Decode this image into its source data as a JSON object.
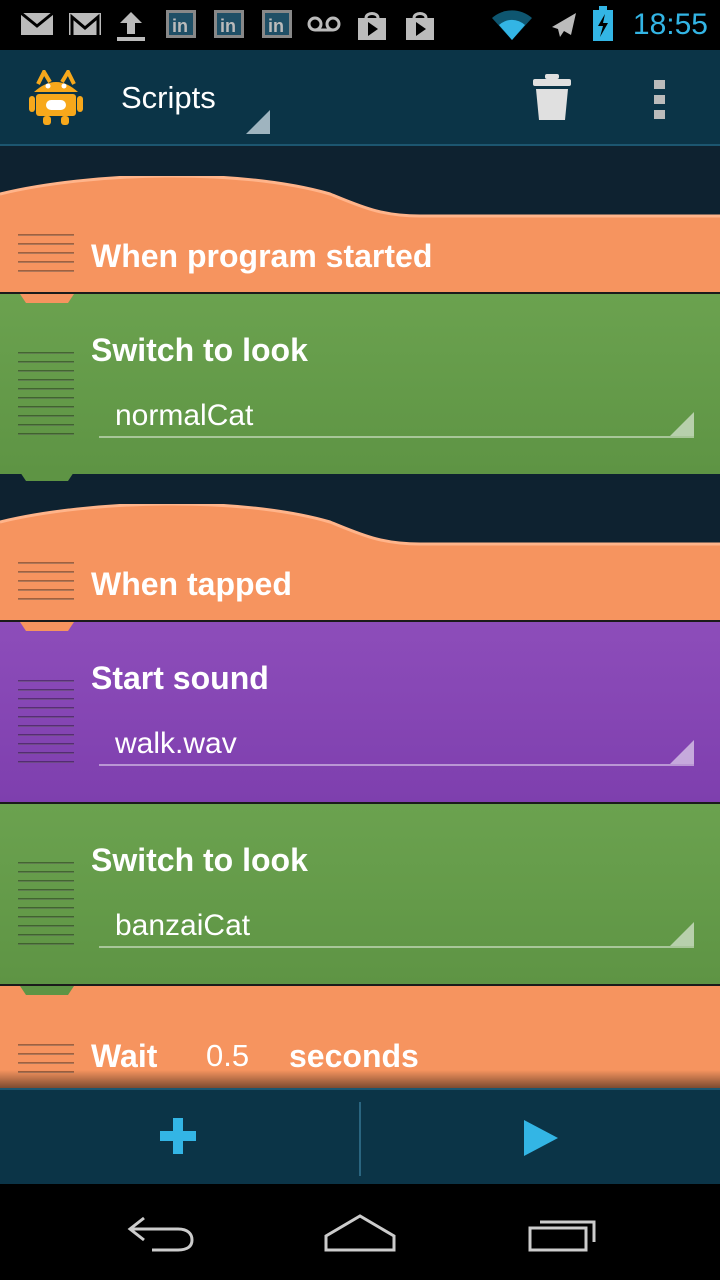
{
  "status_bar": {
    "time": "18:55",
    "icons": [
      "gmail-icon",
      "gmail-icon",
      "upload-icon",
      "linkedin-icon",
      "linkedin-icon",
      "linkedin-icon",
      "voicemail-icon",
      "play-store-icon",
      "play-store-icon",
      "wifi-icon",
      "airplane-icon",
      "battery-charging-icon"
    ],
    "accent_color": "#33b5e5"
  },
  "action_bar": {
    "title": "Scripts",
    "icons": [
      "catroid-logo-icon",
      "trash-icon",
      "overflow-menu-icon"
    ]
  },
  "scripts": [
    {
      "hat": "When program started",
      "bricks": [
        {
          "title": "Switch to look",
          "value": "normalCat",
          "color": "#6ba24f"
        }
      ]
    },
    {
      "hat": "When tapped",
      "bricks": [
        {
          "title": "Start sound",
          "value": "walk.wav",
          "color": "#8d4dba"
        },
        {
          "title": "Switch to look",
          "value": "banzaiCat",
          "color": "#6ba24f"
        }
      ],
      "wait": {
        "label": "Wait",
        "value": "0.5",
        "unit": "seconds"
      }
    }
  ],
  "hat_color": "#f6945f",
  "bottom_bar": {
    "icons": [
      "add-icon",
      "play-icon"
    ]
  },
  "nav_bar": {
    "icons": [
      "back-icon",
      "home-icon",
      "recent-apps-icon"
    ]
  }
}
